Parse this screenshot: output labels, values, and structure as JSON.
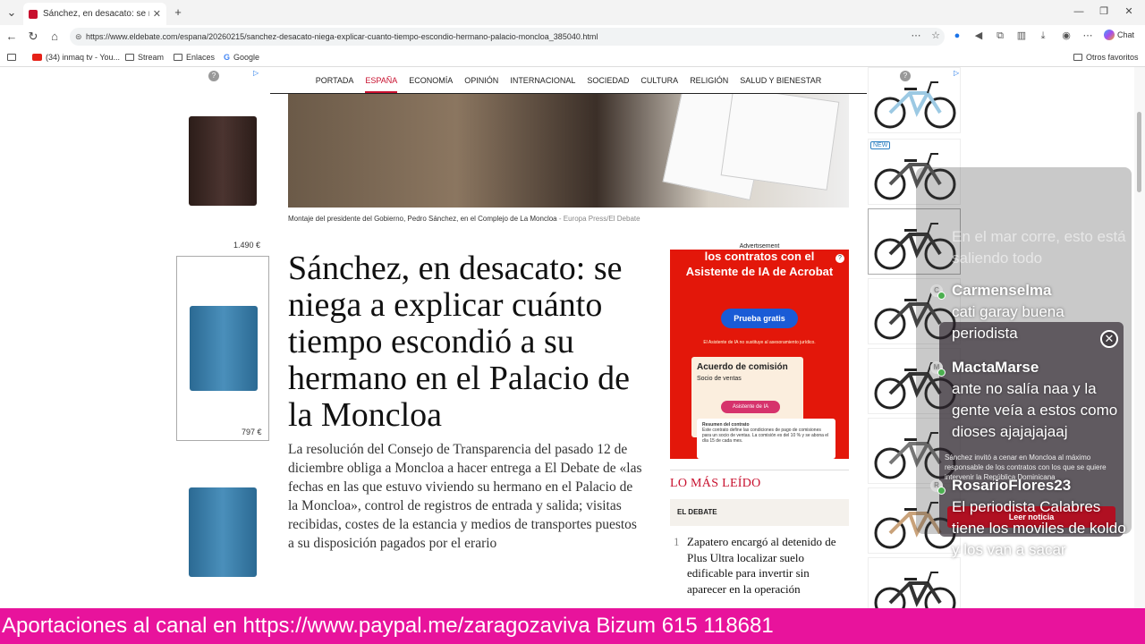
{
  "browser": {
    "tab_title": "Sánchez, en desacato: se niega a e",
    "url": "https://www.eldebate.com/espana/20260215/sanchez-desacato-niega-explicar-cuanto-tiempo-escondio-hermano-palacio-moncloa_385040.html",
    "chat_label": "Chat",
    "bookmarks": [
      "(34) inmaq tv - You...",
      "Stream",
      "Enlaces",
      "Google"
    ],
    "other_bookmarks": "Otros favoritos"
  },
  "nav": {
    "items": [
      "PORTADA",
      "ESPAÑA",
      "ECONOMÍA",
      "OPINIÓN",
      "INTERNACIONAL",
      "SOCIEDAD",
      "CULTURA",
      "RELIGIÓN",
      "SALUD Y BIENESTAR"
    ],
    "active": "ESPAÑA"
  },
  "article": {
    "caption": "Montaje del presidente del Gobierno, Pedro Sánchez, en el Complejo de La Moncloa",
    "credit": " - Europa Press/El Debate",
    "headline": "Sánchez, en desacato: se niega a explicar cuánto tiempo escondió a su hermano en el Palacio de la Moncloa",
    "lead": "La resolución del Consejo de Transparencia del pasado 12 de diciembre obliga a Moncloa a hacer entrega a El Debate de «las fechas en las que estuvo viviendo su hermano en el Palacio de la Moncloa», control de registros de entrada y salida; visitas recibidas, costes de la estancia y medios de transportes puestos a su disposición pagados por el erario"
  },
  "left_ads": {
    "prices": [
      "1.490 €",
      "797 €"
    ]
  },
  "acrobat_ad": {
    "advertisement": "Advertisement",
    "headline": "los contratos con el Asistente de IA de Acrobat",
    "button": "Prueba gratis",
    "fine": "El Asistente de IA no sustituye al asesoramiento jurídico.",
    "card_title": "Acuerdo de comisión",
    "card_sub": "Socio de ventas",
    "chip": "Asistente de IA",
    "summary_title": "Resumen del contrato",
    "summary_text": "Este contrato define las condiciones de pago de comisiones para un socio de ventas. La comisión es del 10 % y se abona el día 15 de cada mes."
  },
  "mas_leido": {
    "title": "LO MÁS LEÍDO",
    "brand": "EL DEBATE",
    "items": [
      {
        "n": "1",
        "text": "Zapatero encargó al detenido de Plus Ultra localizar suelo edificable para invertir sin aparecer en la operación"
      }
    ]
  },
  "bikes": {
    "new_badge": "NEW"
  },
  "popup": {
    "text": "Sánchez invitó a cenar en Moncloa al máximo responsable de los contratos con los que se quiere intervenir la República Dominicana",
    "button": "Leer noticia"
  },
  "chat": {
    "faded": "En el mar corre, esto está saliendo todo",
    "messages": [
      {
        "user": "Carmenselma",
        "avatar": "C",
        "text": "cati garay buena periodista"
      },
      {
        "user": "MactaMarse",
        "avatar": "M",
        "text": "ante no salía naa y la gente veía a estos como dioses ajajajajaaj"
      },
      {
        "user": "RosarioFlores23",
        "avatar": "R",
        "text": "El periodista Calabres tiene los moviles de koldo y los van a sacar"
      }
    ]
  },
  "ticker": "Aportaciones al canal en https://www.paypal.me/zaragozaviva Bizum 615 118681",
  "colors": {
    "accent": "#c8102e",
    "ticker": "#e8139c",
    "acrobat": "#e3170a"
  }
}
